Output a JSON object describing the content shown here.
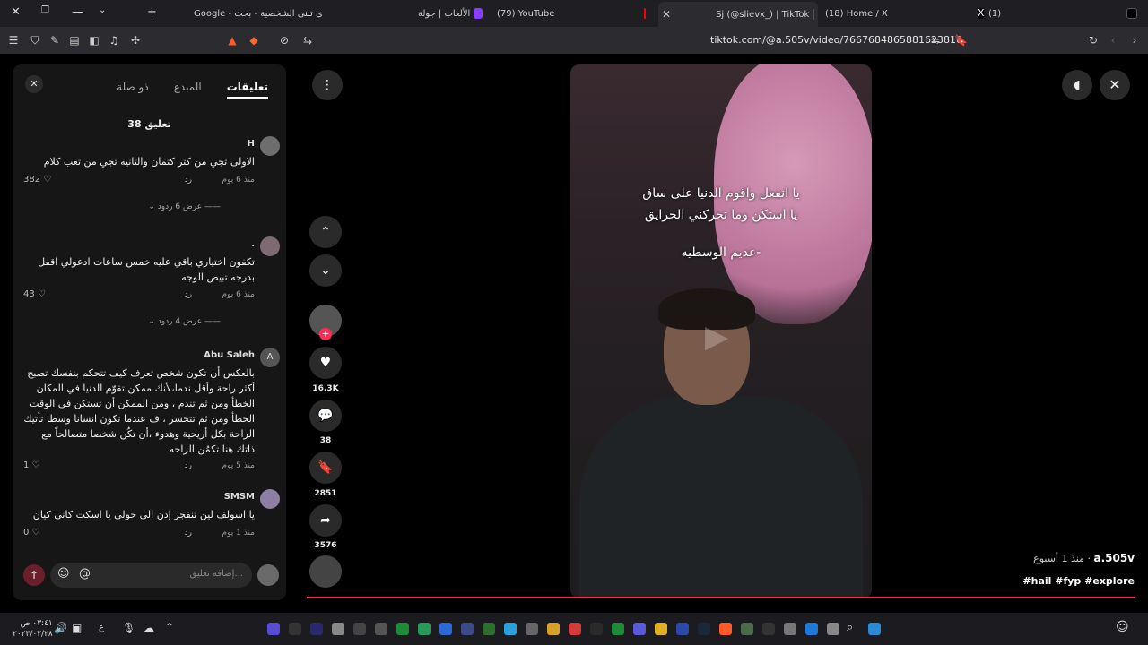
{
  "tabs": [
    {
      "label": "Google - ى تبنى الشخصية - بحث",
      "left": 0
    },
    {
      "label": "الألعاب | جولة",
      "left": 0
    },
    {
      "label": "(79) YouTube",
      "left": 0
    },
    {
      "label": "Sj (@slievx_) | TikTok",
      "left": 0
    },
    {
      "label": "(18) Home / X",
      "left": 0
    },
    {
      "label": "(1)",
      "left": 0
    }
  ],
  "address": {
    "url": "tiktok.com/@a.505v/video/7667684865881623816"
  },
  "comments_panel": {
    "tab_comments": "تعليقات",
    "tab_creator": "المبدع",
    "tab_related": "ذو صلة",
    "count": "38 تعليق",
    "comments": [
      {
        "user": "H",
        "text": "الاولى تجي من كثر كتمان والثانيه تجي من تعب كلام",
        "time": "منذ 6 يوم",
        "reply": "رد",
        "likes": "382",
        "replies": "عرض 6 ردود"
      },
      {
        "user": ".",
        "text": "تكفون اختياري باقي عليه خمس ساعات ادعولي اقفل بدرجه تبيض الوجه",
        "time": "منذ 6 يوم",
        "reply": "رد",
        "likes": "43",
        "replies": "عرض 4 ردود"
      },
      {
        "user": "Abu Saleh",
        "text": "بالعكس أن تكون شخص تعرف كيف تتحكم بنفسك تصبح أكثر راحة وأقل ندما،لأنك ممكن تقوّم الدنيا في المكان الخطأ ومن ثم تندم ، ومن الممكن أن تستكن في الوقت الخطأ ومن ثم تتحسر ، ف عندما تكون انسانا وسطا تأتيك الراحة بكل أريحية وهدوء ،أن تكُن شخصا متصالحاً مع ذاتك هنا تكمُن الراحه",
        "time": "منذ 5 يوم",
        "reply": "رد",
        "likes": "1",
        "replies": ""
      },
      {
        "user": "SMSM",
        "text": "يا اسولف لين تنفجر إذن الي حولي يا اسكت كاني كيان",
        "time": "منذ 1 يوم",
        "reply": "رد",
        "likes": "0",
        "replies": ""
      }
    ],
    "input_placeholder": "إضافة تعليق..."
  },
  "actions": {
    "likes": "16.3K",
    "comments": "38",
    "saves": "2851",
    "shares": "3576"
  },
  "video": {
    "overlay_line1": "يا انفعل واقوم الدنيا على ساق",
    "overlay_line2": "يا استكن وما تحركني الحرايق",
    "overlay_line3": "-عديم الوسطيه",
    "progress_pct": 100
  },
  "caption": {
    "author": "a.505v",
    "age": "· منذ 1 أسبوع",
    "tags": "#hail #fyp #explore"
  },
  "taskbar": {
    "clock_time": "٠٣:٤١ ص",
    "clock_date": "٢٠٢٣/٠٢/٢٨"
  }
}
